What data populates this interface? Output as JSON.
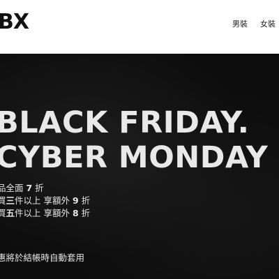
{
  "header": {
    "logo_text": "BX",
    "nav": [
      {
        "label": "男裝"
      },
      {
        "label": "女裝"
      }
    ]
  },
  "hero": {
    "headline_line1": "BLACK FRIDAY.",
    "headline_line2": "CYBER MONDAY",
    "offers": [
      {
        "pre": "品全面 ",
        "bold": "7",
        "post": " 折"
      },
      {
        "pre": "買",
        "bold": "三",
        "mid": "件以上 享額外 ",
        "bold2": "9",
        "post": " 折"
      },
      {
        "pre": "買",
        "bold": "五",
        "mid": "件以上 享額外 ",
        "bold2": "8",
        "post": " 折"
      }
    ],
    "footnote": "惠將於結帳時自動套用"
  },
  "colors": {
    "hero_background": "#0d0d0d",
    "hero_text": "#e8e8e8",
    "header_background": "#ffffff",
    "logo": "#111111"
  }
}
